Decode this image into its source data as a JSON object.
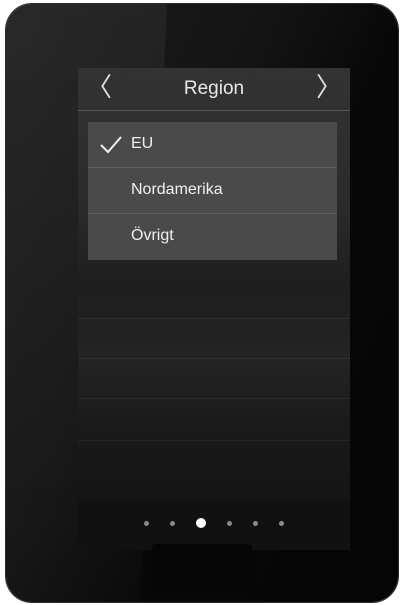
{
  "header": {
    "title": "Region",
    "prev_icon": "chevron-left-icon",
    "next_icon": "chevron-right-icon",
    "prev_glyph": "〈",
    "next_glyph": "〉"
  },
  "regions": {
    "items": [
      {
        "label": "EU",
        "selected": true
      },
      {
        "label": "Nordamerika",
        "selected": false
      },
      {
        "label": "Övrigt",
        "selected": false
      }
    ],
    "check_icon": "checkmark-icon"
  },
  "pager": {
    "page_count": 6,
    "current_page": 3
  },
  "colors": {
    "device": "#111111",
    "list_item": "#4a4a4a",
    "text": "#f0f0f0",
    "active_dot": "#ffffff",
    "inactive_dot": "#8a8a8a"
  }
}
